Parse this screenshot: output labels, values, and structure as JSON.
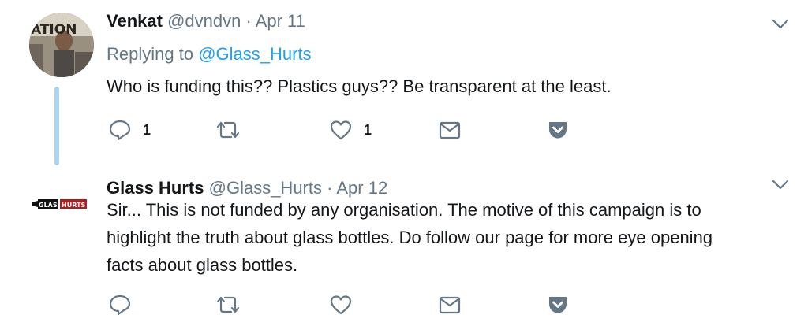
{
  "tweets": [
    {
      "display_name": "Venkat",
      "handle": "@dvndvn",
      "separator": "·",
      "date": "Apr 11",
      "replying_prefix": "Replying to",
      "replying_to": "@Glass_Hurts",
      "text": "Who is funding this?? Plastics guys?? Be transparent at the least.",
      "reply_count": "1",
      "retweet_count": "",
      "like_count": "1",
      "avatar_text": "ATION",
      "avatar_icon": "profile-photo"
    },
    {
      "display_name": "Glass Hurts",
      "handle": "@Glass_Hurts",
      "separator": "·",
      "date": "Apr 12",
      "text_lines": [
        "Sir... This is not funded by any organisation. The motive of this campaign is to",
        "highlight the truth about glass bottles. Do follow our page for more eye opening",
        "facts about glass bottles."
      ],
      "reply_count": "",
      "retweet_count": "",
      "like_count": "",
      "logo_text": "GLASS HURTS"
    }
  ],
  "icons": [
    "chevron-down-icon",
    "reply-icon",
    "retweet-icon",
    "like-icon",
    "direct-message-icon",
    "pocket-icon"
  ],
  "colors": {
    "text": "#14171a",
    "secondary": "#657786",
    "link": "#1da1f2",
    "thread_line": "#a9d4f5",
    "icon": "#657786"
  }
}
